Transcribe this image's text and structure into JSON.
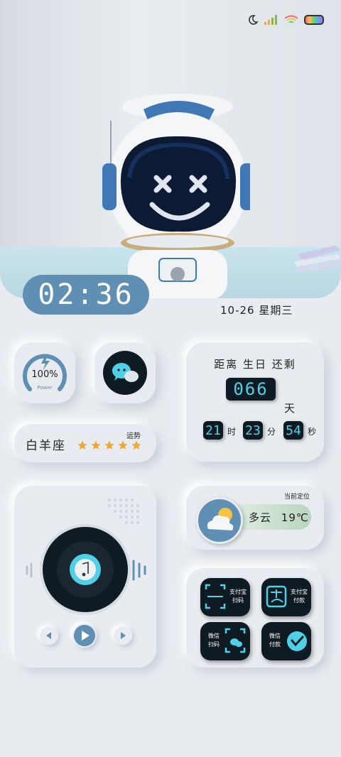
{
  "status_bar": {
    "icons": [
      "moon-icon",
      "signal-icon",
      "wifi-icon",
      "battery-icon"
    ]
  },
  "clock": {
    "time": "02:36"
  },
  "date": {
    "text": "10-26 星期三"
  },
  "power": {
    "percent": "100%",
    "label": "Power",
    "level": 1.0
  },
  "chat": {
    "icon": "wechat-icon"
  },
  "birthday": {
    "title": "距离 生日 还剩",
    "days": "066",
    "days_unit": "天",
    "hours": "21",
    "hours_unit": "时",
    "minutes": "23",
    "minutes_unit": "分",
    "seconds": "54",
    "seconds_unit": "秒"
  },
  "zodiac": {
    "name": "白羊座",
    "fortune_label": "运势",
    "stars": 5
  },
  "music": {
    "icons": [
      "music-note-icon",
      "prev-icon",
      "play-icon",
      "next-icon"
    ]
  },
  "weather": {
    "location_label": "当前定位",
    "condition": "多云",
    "temperature": "19℃"
  },
  "payments": [
    {
      "label_line1": "支付宝",
      "label_line2": "扫码"
    },
    {
      "label_line1": "支付宝",
      "label_line2": "付款"
    },
    {
      "label_line1": "微信",
      "label_line2": "扫码"
    },
    {
      "label_line1": "微信",
      "label_line2": "付款"
    }
  ],
  "colors": {
    "accent": "#5f8fb3",
    "digit_text": "#4fd0e6",
    "star": "#f2a531",
    "background": "#e8ecf0"
  }
}
